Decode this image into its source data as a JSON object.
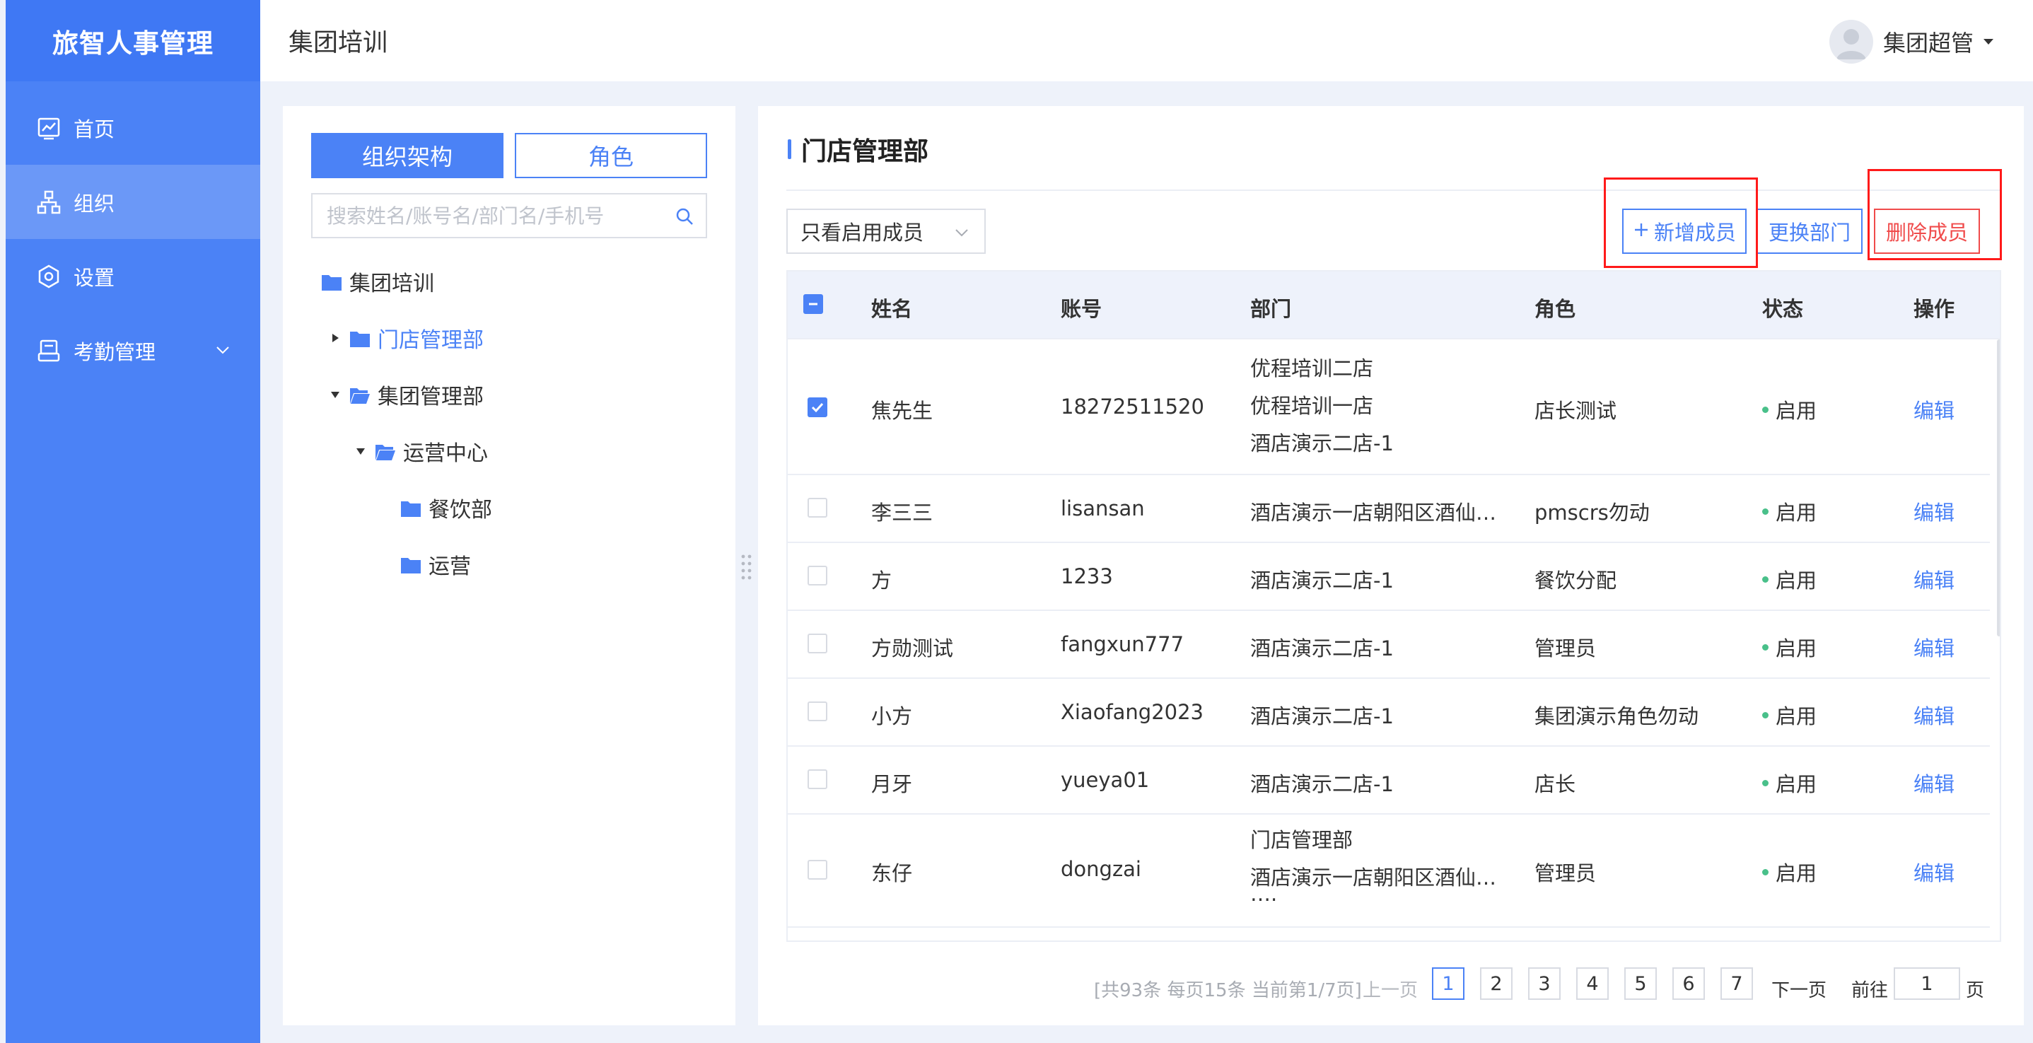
{
  "app": {
    "title": "旅智人事管理"
  },
  "sidebar": {
    "items": [
      {
        "label": "首页",
        "icon": "chart-line-icon"
      },
      {
        "label": "组织",
        "icon": "org-chart-icon",
        "active": true
      },
      {
        "label": "设置",
        "icon": "gear-icon"
      },
      {
        "label": "考勤管理",
        "icon": "clipboard-icon",
        "expandable": true
      }
    ]
  },
  "header": {
    "title": "集团培训",
    "user_name": "集团超管"
  },
  "left_panel": {
    "tabs": [
      "组织架构",
      "角色"
    ],
    "active_tab": "组织架构",
    "search_placeholder": "搜索姓名/账号名/部门名/手机号",
    "tree": [
      {
        "label": "集团培训",
        "level": 0
      },
      {
        "label": "门店管理部",
        "level": 1,
        "state": "collapsed",
        "selected": true
      },
      {
        "label": "集团管理部",
        "level": 1,
        "state": "expanded"
      },
      {
        "label": "运营中心",
        "level": 2,
        "state": "expanded"
      },
      {
        "label": "餐饮部",
        "level": 3
      },
      {
        "label": "运营",
        "level": 3
      }
    ]
  },
  "right_panel": {
    "title": "门店管理部",
    "filter": {
      "selected": "只看启用成员"
    },
    "buttons": {
      "add": "新增成员",
      "change": "更换部门",
      "delete": "删除成员"
    },
    "columns": [
      "姓名",
      "账号",
      "部门",
      "角色",
      "状态",
      "操作"
    ],
    "rows": [
      {
        "name": "焦先生",
        "account": "18272511520",
        "dept": [
          "优程培训二店",
          "优程培训一店",
          "酒店演示二店-1"
        ],
        "role": "店长测试",
        "status": "启用",
        "action": "编辑",
        "checked": true
      },
      {
        "name": "李三三",
        "account": "lisansan",
        "dept": [
          "酒店演示一店朝阳区酒仙…"
        ],
        "role": "pmscrs勿动",
        "status": "启用",
        "action": "编辑",
        "checked": false
      },
      {
        "name": "方",
        "account": "1233",
        "dept": [
          "酒店演示二店-1"
        ],
        "role": "餐饮分配",
        "status": "启用",
        "action": "编辑",
        "checked": false
      },
      {
        "name": "方勋测试",
        "account": "fangxun777",
        "dept": [
          "酒店演示二店-1"
        ],
        "role": "管理员",
        "status": "启用",
        "action": "编辑",
        "checked": false
      },
      {
        "name": "小方",
        "account": "Xiaofang2023",
        "dept": [
          "酒店演示二店-1"
        ],
        "role": "集团演示角色勿动",
        "status": "启用",
        "action": "编辑",
        "checked": false
      },
      {
        "name": "月牙",
        "account": "yueya01",
        "dept": [
          "酒店演示二店-1"
        ],
        "role": "店长",
        "status": "启用",
        "action": "编辑",
        "checked": false
      },
      {
        "name": "东仔",
        "account": "dongzai",
        "dept": [
          "门店管理部",
          "酒店演示一店朝阳区酒仙…",
          "…."
        ],
        "role": "管理员",
        "status": "启用",
        "action": "编辑",
        "checked": false
      }
    ]
  },
  "pagination": {
    "summary": "[共93条 每页15条 当前第1/7页]",
    "prev": "上一页",
    "pages": [
      "1",
      "2",
      "3",
      "4",
      "5",
      "6",
      "7"
    ],
    "current": "1",
    "next": "下一页",
    "goto_label": "前往",
    "goto_value": "1",
    "page_suffix": "页"
  },
  "colors": {
    "sidebar": "#4b82f6",
    "accent": "#4b82f6",
    "danger": "#f04b4b",
    "status_dot": "#49c08a",
    "highlight_box": "#ff1a1a"
  }
}
